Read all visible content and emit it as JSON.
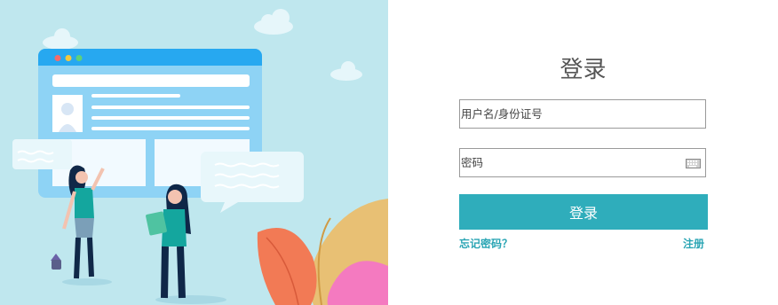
{
  "login": {
    "title": "登录",
    "username_placeholder": "用户名/身份证号",
    "password_placeholder": "密码",
    "submit_label": "登录",
    "forgot_label": "忘记密码？",
    "register_label": "注册"
  },
  "icons": {
    "keyboard": "keyboard-icon"
  },
  "colors": {
    "accent": "#2fadbb",
    "link": "#2aa5b4",
    "illustration_bg": "#bfe7ee"
  }
}
